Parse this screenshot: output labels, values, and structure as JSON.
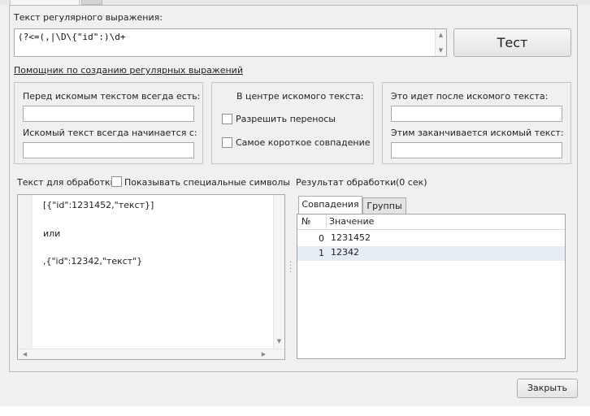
{
  "regex": {
    "label": "Текст регулярного выражения:",
    "value": "(?<=(,|\\D\\{\"id\":)\\d+",
    "test_button": "Тест"
  },
  "helper": {
    "link": "Помощник по созданию регулярных выражений",
    "before": {
      "label1": "Перед искомым текстом всегда есть:",
      "label2": "Искомый текст всегда начинается с:",
      "value1": "",
      "value2": ""
    },
    "middle": {
      "title": "В центре искомого текста:",
      "opt1": "Разрешить переносы",
      "opt2": "Самое короткое совпадение",
      "opt1_checked": false,
      "opt2_checked": false
    },
    "after": {
      "label1": "Это идет после искомого текста:",
      "label2": "Этим заканчивается искомый текст:",
      "value1": "",
      "value2": ""
    }
  },
  "source": {
    "label": "Текст для обработки",
    "show_special": "Показывать специальные символы",
    "lines": [
      "[{\"id\":1231452,\"текст}]",
      "или",
      ",{\"id\":12342,\"текст\"}"
    ]
  },
  "result": {
    "label": "Результат обработки",
    "time": "(0 сек)",
    "tabs": [
      "Совпадения",
      "Группы"
    ],
    "columns": [
      "№",
      "Значение"
    ],
    "rows": [
      {
        "index": "0",
        "value": "1231452"
      },
      {
        "index": "1",
        "value": "12342"
      }
    ]
  },
  "close_button": "Закрыть",
  "colors": {
    "selected_row": "#e6ecf4",
    "window_bg": "#f0f0f0",
    "border": "#a9a9a9"
  },
  "icons": [
    "scroll-up-arrow-icon",
    "scroll-down-arrow-icon",
    "scroll-left-arrow-icon",
    "scroll-right-arrow-icon",
    "splitter-grip-icon"
  ]
}
